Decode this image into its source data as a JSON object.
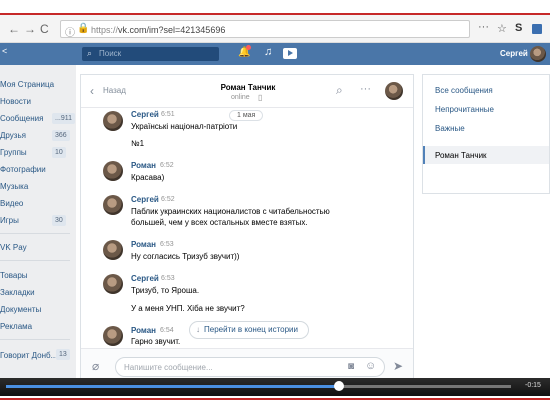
{
  "browser": {
    "url_prefix": "https://",
    "url_main": "vk.com/im?sel=421345696",
    "menu_icon": "···",
    "star_icon": "☆",
    "extension_label": "S"
  },
  "vk_header": {
    "search_placeholder": "Поиск",
    "user_name": "Сергей"
  },
  "left_menu": [
    {
      "label": "Моя Страница"
    },
    {
      "label": "Новости"
    },
    {
      "label": "Сообщения",
      "count": "...911"
    },
    {
      "label": "Друзья",
      "count": "366"
    },
    {
      "label": "Группы",
      "count": "10"
    },
    {
      "label": "Фотографии"
    },
    {
      "label": "Музыка"
    },
    {
      "label": "Видео"
    },
    {
      "label": "Игры",
      "count": "30"
    },
    {
      "label": "VK Pay"
    },
    {
      "label": "Товары"
    },
    {
      "label": "Закладки"
    },
    {
      "label": "Документы"
    },
    {
      "label": "Реклама"
    },
    {
      "label": "Говорит Донб...",
      "count": "13"
    }
  ],
  "chat": {
    "back_label": "Назад",
    "title": "Роман Танчик",
    "status": "online",
    "date_badge": "1 мая",
    "scroll_button_label": "Перейти в конец истории",
    "composer_placeholder": "Напишите сообщение...",
    "messages": [
      {
        "sender": "Сергей",
        "time": "6:51",
        "lines": [
          "Українські націонал-патріоти",
          "",
          "№1"
        ]
      },
      {
        "sender": "Роман",
        "time": "6:52",
        "lines": [
          "Красава)"
        ]
      },
      {
        "sender": "Сергей",
        "time": "6:52",
        "lines": [
          "Паблик украинских националистов с читабельностью",
          "большей, чем у всех остальных вместе взятых."
        ]
      },
      {
        "sender": "Роман",
        "time": "6:53",
        "lines": [
          "Ну согласись Тризуб звучит))"
        ]
      },
      {
        "sender": "Сергей",
        "time": "6:53",
        "lines": [
          "Тризуб, то Яроша.",
          "",
          "У а меня УНП. Хіба не звучит?"
        ]
      },
      {
        "sender": "Роман",
        "time": "6:54",
        "lines": [
          "Гарно звучит."
        ]
      }
    ]
  },
  "right_panel": {
    "items": [
      "Все сообщения",
      "Непрочитанные",
      "Важные",
      "Роман Танчик"
    ]
  },
  "video": {
    "played_fraction": 0.66,
    "time_label": "-0:15"
  }
}
